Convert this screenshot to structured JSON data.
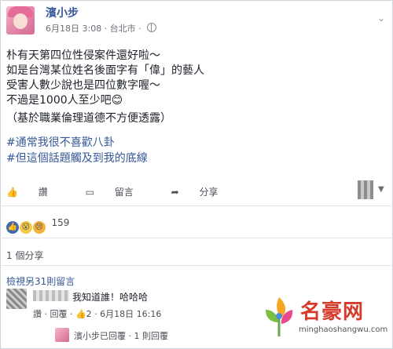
{
  "post": {
    "author": "濱小步",
    "meta": "6月18日 3:08 · 台北市 ·",
    "lines": [
      "朴有天第四位性侵案件還好啦～",
      "如是台灣某位姓名後面字有「偉」的藝人",
      "受害人數少說也是四位數字喔～",
      "不過是1000人至少吧😊",
      "（基於職業倫理道德不方便透露）"
    ],
    "hashtags": [
      "#通常我很不喜歡八卦",
      "#但這個話題觸及到我的底線"
    ]
  },
  "actions": {
    "like": "讚",
    "comment": "留言",
    "share": "分享"
  },
  "reactions": {
    "count": "159"
  },
  "shares": "1 個分享",
  "comments": {
    "view_more": "檢視另31則留言",
    "first": {
      "text": "我知道誰！哈哈哈",
      "actions": "讚 · 回覆 · 👍2 · 6月18日 16:16"
    },
    "reply": "濱小步已回覆 · 1 則回覆"
  },
  "watermark": {
    "brand": "名豪网",
    "url": "minghaoshangwu.com"
  }
}
